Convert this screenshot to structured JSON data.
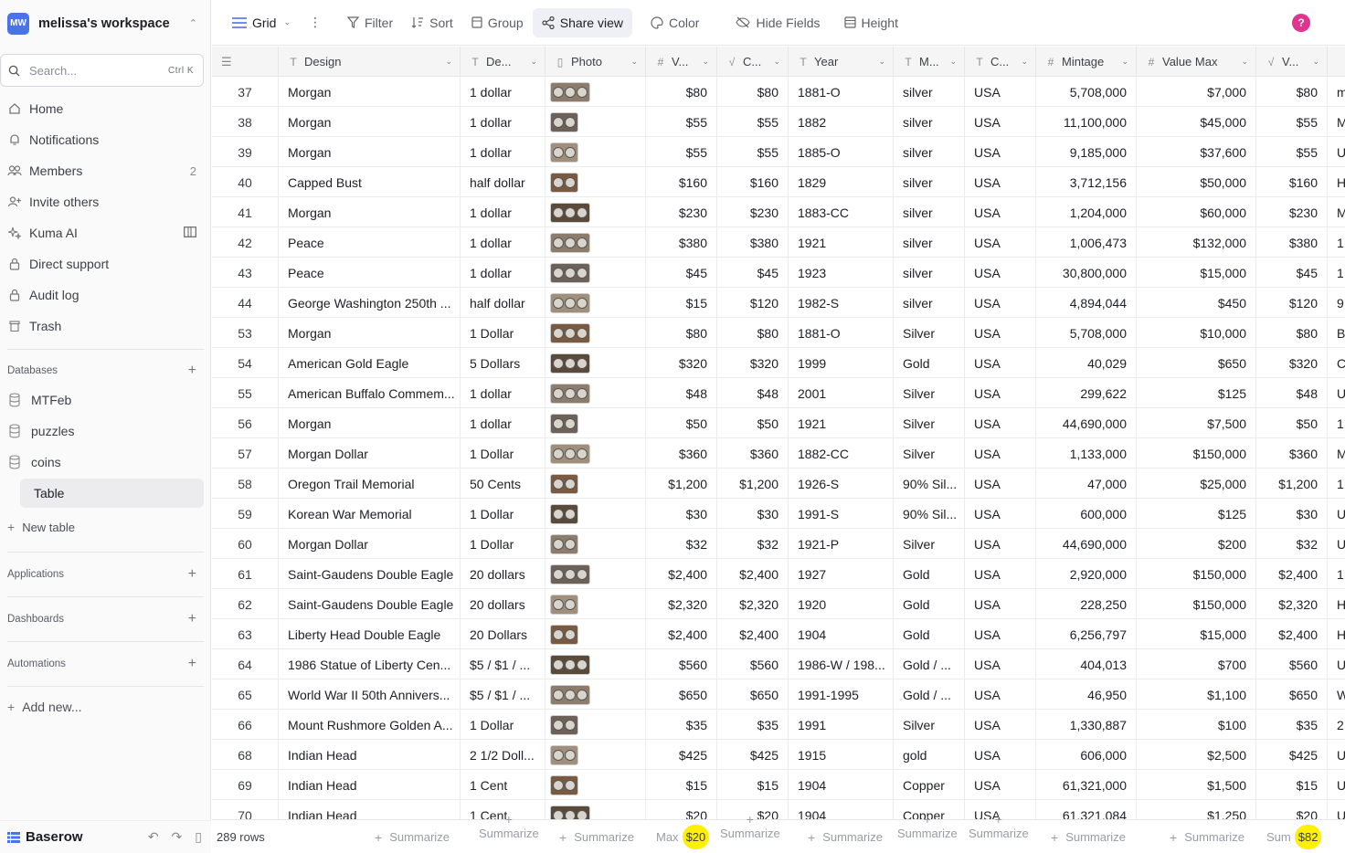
{
  "workspace": {
    "initials": "MW",
    "name": "melissa's workspace"
  },
  "search": {
    "placeholder": "Search...",
    "shortcut": "Ctrl K"
  },
  "nav": [
    {
      "label": "Home",
      "icon": "home-icon"
    },
    {
      "label": "Notifications",
      "icon": "bell-icon"
    },
    {
      "label": "Members",
      "icon": "members-icon",
      "count": "2"
    },
    {
      "label": "Invite others",
      "icon": "invite-icon"
    },
    {
      "label": "Kuma AI",
      "icon": "sparkle-icon"
    },
    {
      "label": "Direct support",
      "icon": "lock-icon"
    },
    {
      "label": "Audit log",
      "icon": "lock-icon"
    },
    {
      "label": "Trash",
      "icon": "trash-icon"
    }
  ],
  "sections": {
    "databases": "Databases",
    "applications": "Applications",
    "dashboards": "Dashboards",
    "automations": "Automations"
  },
  "databases": [
    "MTFeb",
    "puzzles",
    "coins"
  ],
  "active_table": "Table",
  "new_table": "New table",
  "add_new": "Add new...",
  "brand": "Baserow",
  "toolbar": {
    "view": "Grid",
    "filter": "Filter",
    "sort": "Sort",
    "group": "Group",
    "share": "Share view",
    "color": "Color",
    "hide": "Hide Fields",
    "height": "Height",
    "help": "?"
  },
  "columns": [
    {
      "name": "Design",
      "type": "T"
    },
    {
      "name": "De...",
      "type": "T"
    },
    {
      "name": "Photo",
      "type": "file"
    },
    {
      "name": "V...",
      "type": "#"
    },
    {
      "name": "C...",
      "type": "fx"
    },
    {
      "name": "Year",
      "type": "T"
    },
    {
      "name": "M...",
      "type": "T"
    },
    {
      "name": "C...",
      "type": "T"
    },
    {
      "name": "Mintage",
      "type": "#"
    },
    {
      "name": "Value Max",
      "type": "#"
    },
    {
      "name": "V...",
      "type": "fx"
    }
  ],
  "rows": [
    [
      "37",
      "Morgan",
      "1 dollar",
      "$80",
      "$80",
      "1881-O",
      "silver",
      "USA",
      "5,708,000",
      "$7,000",
      "$80",
      "m"
    ],
    [
      "38",
      "Morgan",
      "1 dollar",
      "$55",
      "$55",
      "1882",
      "silver",
      "USA",
      "11,100,000",
      "$45,000",
      "$55",
      "M"
    ],
    [
      "39",
      "Morgan",
      "1 dollar",
      "$55",
      "$55",
      "1885-O",
      "silver",
      "USA",
      "9,185,000",
      "$37,600",
      "$55",
      "U"
    ],
    [
      "40",
      "Capped Bust",
      "half dollar",
      "$160",
      "$160",
      "1829",
      "silver",
      "USA",
      "3,712,156",
      "$50,000",
      "$160",
      "H"
    ],
    [
      "41",
      "Morgan",
      "1 dollar",
      "$230",
      "$230",
      "1883-CC",
      "silver",
      "USA",
      "1,204,000",
      "$60,000",
      "$230",
      "M"
    ],
    [
      "42",
      "Peace",
      "1 dollar",
      "$380",
      "$380",
      "1921",
      "silver",
      "USA",
      "1,006,473",
      "$132,000",
      "$380",
      "1"
    ],
    [
      "43",
      "Peace",
      "1 dollar",
      "$45",
      "$45",
      "1923",
      "silver",
      "USA",
      "30,800,000",
      "$15,000",
      "$45",
      "1"
    ],
    [
      "44",
      "George Washington 250th ...",
      "half dollar",
      "$15",
      "$120",
      "1982-S",
      "silver",
      "USA",
      "4,894,044",
      "$450",
      "$120",
      "9"
    ],
    [
      "53",
      "Morgan",
      "1 Dollar",
      "$80",
      "$80",
      "1881-O",
      "Silver",
      "USA",
      "5,708,000",
      "$10,000",
      "$80",
      "B"
    ],
    [
      "54",
      "American Gold Eagle",
      "5 Dollars",
      "$320",
      "$320",
      "1999",
      "Gold",
      "USA",
      "40,029",
      "$650",
      "$320",
      "C"
    ],
    [
      "55",
      "American Buffalo Commem...",
      "1 dollar",
      "$48",
      "$48",
      "2001",
      "Silver",
      "USA",
      "299,622",
      "$125",
      "$48",
      "U"
    ],
    [
      "56",
      "Morgan",
      "1 dollar",
      "$50",
      "$50",
      "1921",
      "Silver",
      "USA",
      "44,690,000",
      "$7,500",
      "$50",
      "1"
    ],
    [
      "57",
      "Morgan Dollar",
      "1 Dollar",
      "$360",
      "$360",
      "1882-CC",
      "Silver",
      "USA",
      "1,133,000",
      "$150,000",
      "$360",
      "M"
    ],
    [
      "58",
      "Oregon Trail Memorial",
      "50 Cents",
      "$1,200",
      "$1,200",
      "1926-S",
      "90% Sil...",
      "USA",
      "47,000",
      "$25,000",
      "$1,200",
      "1"
    ],
    [
      "59",
      "Korean War Memorial",
      "1 Dollar",
      "$30",
      "$30",
      "1991-S",
      "90% Sil...",
      "USA",
      "600,000",
      "$125",
      "$30",
      "U"
    ],
    [
      "60",
      "Morgan Dollar",
      "1 Dollar",
      "$32",
      "$32",
      "1921-P",
      "Silver",
      "USA",
      "44,690,000",
      "$200",
      "$32",
      "U"
    ],
    [
      "61",
      "Saint-Gaudens Double Eagle",
      "20 dollars",
      "$2,400",
      "$2,400",
      "1927",
      "Gold",
      "USA",
      "2,920,000",
      "$150,000",
      "$2,400",
      "1"
    ],
    [
      "62",
      "Saint-Gaudens Double Eagle",
      "20 dollars",
      "$2,320",
      "$2,320",
      "1920",
      "Gold",
      "USA",
      "228,250",
      "$150,000",
      "$2,320",
      "H"
    ],
    [
      "63",
      "Liberty Head Double Eagle",
      "20 Dollars",
      "$2,400",
      "$2,400",
      "1904",
      "Gold",
      "USA",
      "6,256,797",
      "$15,000",
      "$2,400",
      "H"
    ],
    [
      "64",
      "1986 Statue of Liberty Cen...",
      "$5 / $1 / ...",
      "$560",
      "$560",
      "1986-W / 198...",
      "Gold / ...",
      "USA",
      "404,013",
      "$700",
      "$560",
      "U"
    ],
    [
      "65",
      "World War II 50th Annivers...",
      "$5 / $1 / ...",
      "$650",
      "$650",
      "1991-1995",
      "Gold / ...",
      "USA",
      "46,950",
      "$1,100",
      "$650",
      "W"
    ],
    [
      "66",
      "Mount Rushmore Golden A...",
      "1 Dollar",
      "$35",
      "$35",
      "1991",
      "Silver",
      "USA",
      "1,330,887",
      "$100",
      "$35",
      "2"
    ],
    [
      "68",
      "Indian Head",
      "2 1/2 Doll...",
      "$425",
      "$425",
      "1915",
      "gold",
      "USA",
      "606,000",
      "$2,500",
      "$425",
      "U"
    ],
    [
      "69",
      "Indian Head",
      "1 Cent",
      "$15",
      "$15",
      "1904",
      "Copper",
      "USA",
      "61,321,000",
      "$1,500",
      "$15",
      "U"
    ],
    [
      "70",
      "Indian Head",
      "1 Cent",
      "$20",
      "$20",
      "1904",
      "Copper",
      "USA",
      "61,321,084",
      "$1,250",
      "$20",
      "U"
    ]
  ],
  "footer": {
    "rows": "289 rows",
    "summarize": "Summarize",
    "max_label": "Max",
    "max_value": "$20",
    "sum_label": "Sum",
    "sum_value": "$82"
  },
  "colors": {
    "accent": "#4a73e8",
    "help": "#e0358e",
    "highlight": "#ffef00"
  }
}
